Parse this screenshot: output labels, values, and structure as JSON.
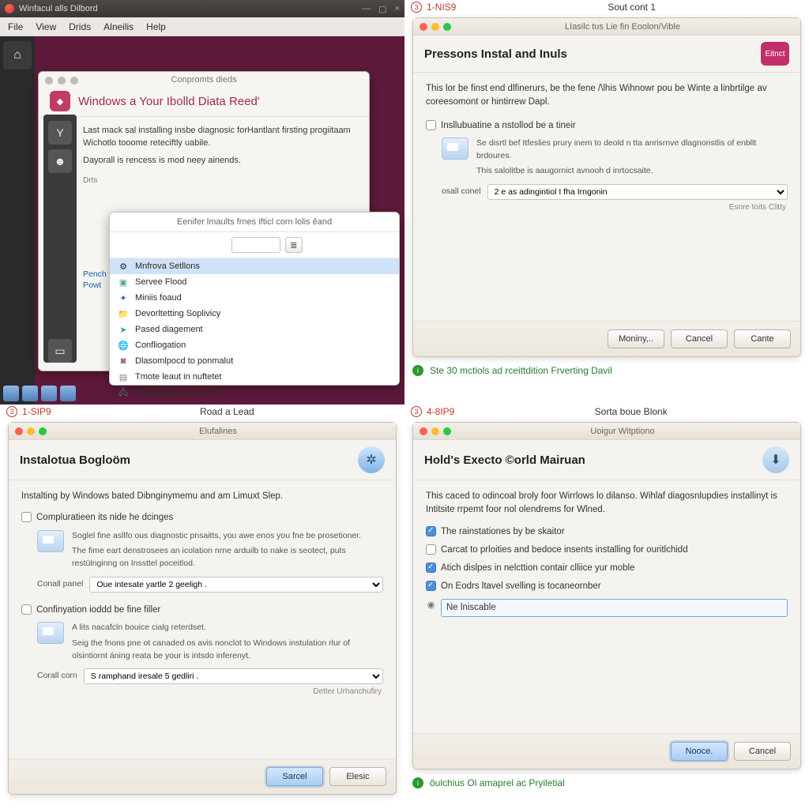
{
  "q1": {
    "window_title": "Winfacul alls Dilbord",
    "menubar": [
      "File",
      "View",
      "Drids",
      "Alneilis",
      "Help"
    ],
    "primary": {
      "sub_title": "Conpromts dieds",
      "hero_title": "Windows a Your Ibolld Diata Reed'",
      "body_line1": "Last mack sal installing insbe diagnosic forHantlant firsting progiitaam Wichotlo tooome reteciftly uabile.",
      "body_line2": "Dayorall is rencess is mod neey ainends.",
      "body_small": "Drts",
      "link1": "Pench",
      "link2": "Powt"
    },
    "secondary": {
      "sheet_title": "Eenifer lmaults frnes ifticl corn lolis êand",
      "items": [
        "Mnfrova Setllons",
        "Servee Flood",
        "Miniis foaud",
        "Devorltetting Soplivicy",
        "Pased diagement",
        "Confliogation",
        "Dlasomlpocd to ponmalut",
        "Tmote leaut in nuftetet",
        "Cadcling ling Sedrens"
      ]
    }
  },
  "q2": {
    "step": "1-NIS9",
    "center": "Sout cont 1",
    "titlebar": "LIasilc tus Lie fin Eoolon/Vible",
    "heading": "Pressons Instal and Inuls",
    "badge": "Eitnct",
    "intro": "This lor be finst end dlfinerurs, be the fene /\\lhis Wihnowr pou be Winte a linbrtilge av coreesomont or hintirrew Dapl.",
    "chk_label": "Insllubuatine a nstollod be a tineir",
    "info1": "Se disrtl bef Itfeslies prury inem to deold n tta anrisrnve dlagnonstlis of enbllt brdoures.",
    "info2": "This salolitbe is aaugornict avnooh d inrtocsaite.",
    "select_label": "osall conel",
    "select_value": "2 e as adingintiol I fha Irngonin",
    "right_note": "Esnre toits Clitty",
    "btn_more": "Moniny,..",
    "btn_cancel": "Cancel",
    "btn_ok": "Cante",
    "caption": "Ste 30 mctiols ad rceittdition Frverting Davil"
  },
  "q3": {
    "step": "1-SIP9",
    "center": "Road a Lead",
    "titlebar": "Elufalines",
    "heading": "Instalotua Bogloöm",
    "intro": "Instalting by Windows bated Dibnginymemu and am Limuxt Slep.",
    "chk1": "Compluratieen its nide he dcinges",
    "info1a": "Soglel fine asllfo ous diagnostic pnsaitts, you awe enos you fne be prosetioner.",
    "info1b": "The fime eart denstrosees an icolation nrne arduilb to nake is seotect, puts restülnginng on Inssttel poceitlod.",
    "sel1_label": "Conall panel",
    "sel1_value": "Oue intesate yartle 2 geeligh .",
    "chk2": "Confinyation ioddd be fine filler",
    "info2a": "A lits nacafcln bouice cialg reterdset.",
    "info2b": "Seig the fnons pne ot canaded os avis nonclot to Windows instulation rlur of olsintiornt áning reata be your is intsdo inferenyt.",
    "sel2_label": "Corall corn",
    "sel2_value": "S ramphand iresale 5 gedliri .",
    "right_note": "Detter Urhanchufiry",
    "btn_primary": "Sarcel",
    "btn_secondary": "Elesic"
  },
  "q4": {
    "step": "4-8IP9",
    "center": "Sorta boue Blonk",
    "titlebar": "Uoigur Witptiono",
    "heading": "Hold's Execto ©orld Mairuan",
    "intro": "This caced to odincoal broly foor Wirrlows lo dilanso. Wihlaf diagosnlupdies installinyt is Intitsite rrpemt foor nol olendrems for Wlned.",
    "opts": [
      {
        "label": "The rainstationes by be skaitor",
        "checked": true
      },
      {
        "label": "Carcat to prloities and bedoce insents installing for ouritlchidd",
        "checked": false
      },
      {
        "label": "Atich dislpes in nelcttion contair clliice yur moble",
        "checked": true
      },
      {
        "label": "On Eodrs ltavel svelling is tocaneornber",
        "checked": true
      }
    ],
    "editable": "Ne lniscable",
    "btn_primary": "Nooce.",
    "btn_secondary": "Cancel",
    "caption": "ôulchius Ol amaprel ac Pryiletial"
  }
}
